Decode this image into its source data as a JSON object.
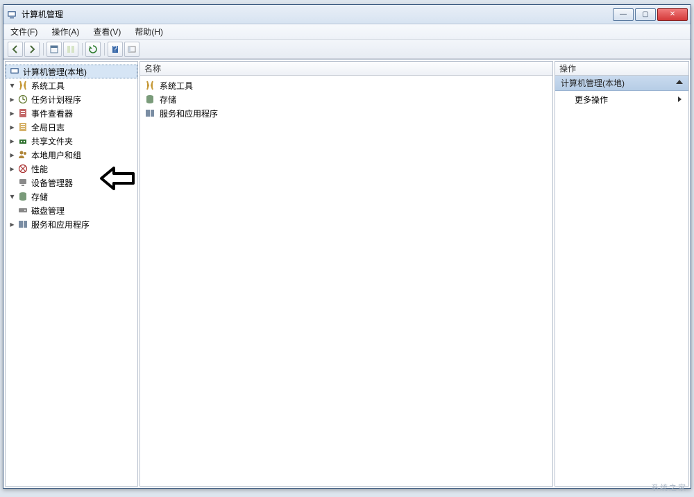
{
  "title": "计算机管理",
  "menu": {
    "file": "文件(F)",
    "action": "操作(A)",
    "view": "查看(V)",
    "help": "帮助(H)"
  },
  "left_header": "计算机管理(本地)",
  "mid_header": "名称",
  "right_header": "操作",
  "tree": {
    "root": "计算机管理(本地)",
    "systools": "系统工具",
    "task": "任务计划程序",
    "event": "事件查看器",
    "global": "全局日志",
    "share": "共享文件夹",
    "localuser": "本地用户和组",
    "perf": "性能",
    "device": "设备管理器",
    "storage": "存储",
    "disk": "磁盘管理",
    "services": "服务和应用程序"
  },
  "list": {
    "systools": "系统工具",
    "storage": "存储",
    "services": "服务和应用程序"
  },
  "actions": {
    "heading": "计算机管理(本地)",
    "more": "更多操作"
  },
  "watermark": "系统之家"
}
